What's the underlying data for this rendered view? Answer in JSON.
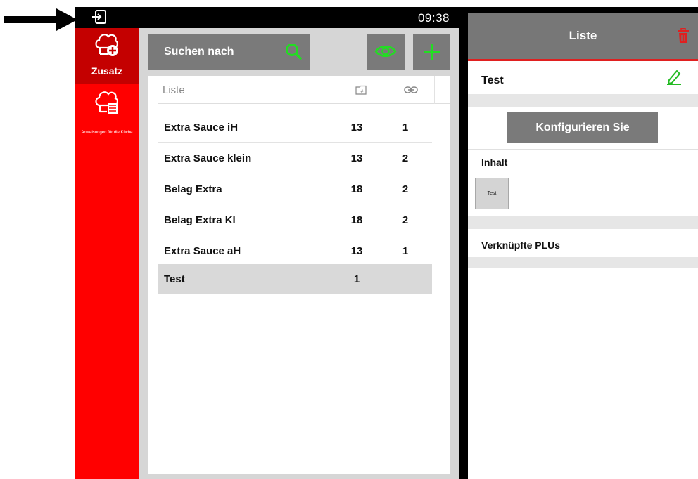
{
  "topbar": {
    "time": "09:38"
  },
  "sidebar": {
    "items": [
      {
        "label": "Zusatz",
        "active": true
      },
      {
        "label": "Anweisungen für die Küche",
        "active": false
      }
    ]
  },
  "search": {
    "placeholder": "Suchen nach"
  },
  "list": {
    "column_name": "Liste",
    "rows": [
      {
        "name": "Extra Sauce iH",
        "c1": "13",
        "c2": "1"
      },
      {
        "name": "Extra Sauce klein",
        "c1": "13",
        "c2": "2"
      },
      {
        "name": "Belag Extra",
        "c1": "18",
        "c2": "2"
      },
      {
        "name": "Belag Extra Kl",
        "c1": "18",
        "c2": "2"
      },
      {
        "name": "Extra Sauce aH",
        "c1": "13",
        "c2": "1"
      },
      {
        "name": "Test",
        "c1": "1",
        "c2": ""
      }
    ],
    "selected_row": "Test"
  },
  "detail": {
    "header_title": "Liste",
    "item_title": "Test",
    "configure_label": "Konfigurieren Sie",
    "content_label": "Inhalt",
    "content_items": [
      "Test"
    ],
    "linked_plus_label": "Verknüpfte PLUs"
  },
  "colors": {
    "sidebar_red": "#ff0000",
    "sidebar_active": "#c40000",
    "accent_green": "#22dd22",
    "button_gray": "#7a7a7a",
    "delete_red": "#e02020"
  },
  "icons": {
    "topbar": "exit-icon",
    "sidebar": [
      "chef-hat-add-icon",
      "chef-hat-list-icon"
    ],
    "search": "search-icon",
    "toolbar": [
      "eye-icon",
      "plus-icon"
    ],
    "list_header": [
      "folder-icon",
      "link-icon"
    ],
    "detail": [
      "trash-icon",
      "pencil-icon"
    ]
  }
}
